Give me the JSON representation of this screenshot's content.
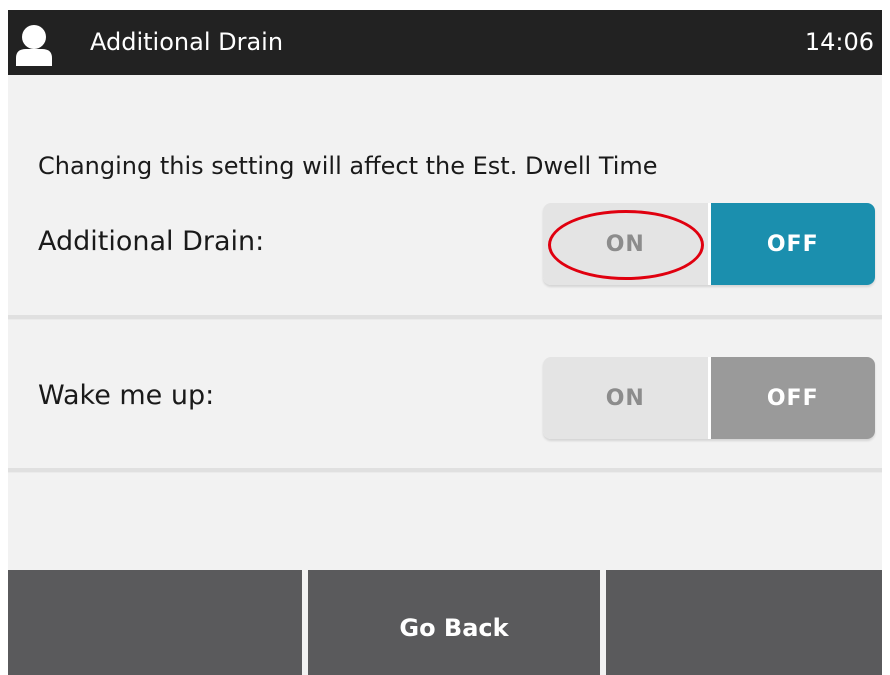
{
  "header": {
    "title": "Additional Drain",
    "clock": "14:06",
    "icon": "user-icon"
  },
  "notice": "Changing this setting will affect the Est. Dwell Time",
  "settings": [
    {
      "label": "Additional Drain:",
      "on_label": "ON",
      "off_label": "OFF",
      "selected": "OFF",
      "off_color": "#1b8fae"
    },
    {
      "label": "Wake me up:",
      "on_label": "ON",
      "off_label": "OFF",
      "selected": "OFF",
      "off_color": "#9a9a9a"
    }
  ],
  "footer": {
    "left_label": "",
    "center_label": "Go Back",
    "right_label": ""
  },
  "annotation": {
    "color": "#e0000f"
  }
}
